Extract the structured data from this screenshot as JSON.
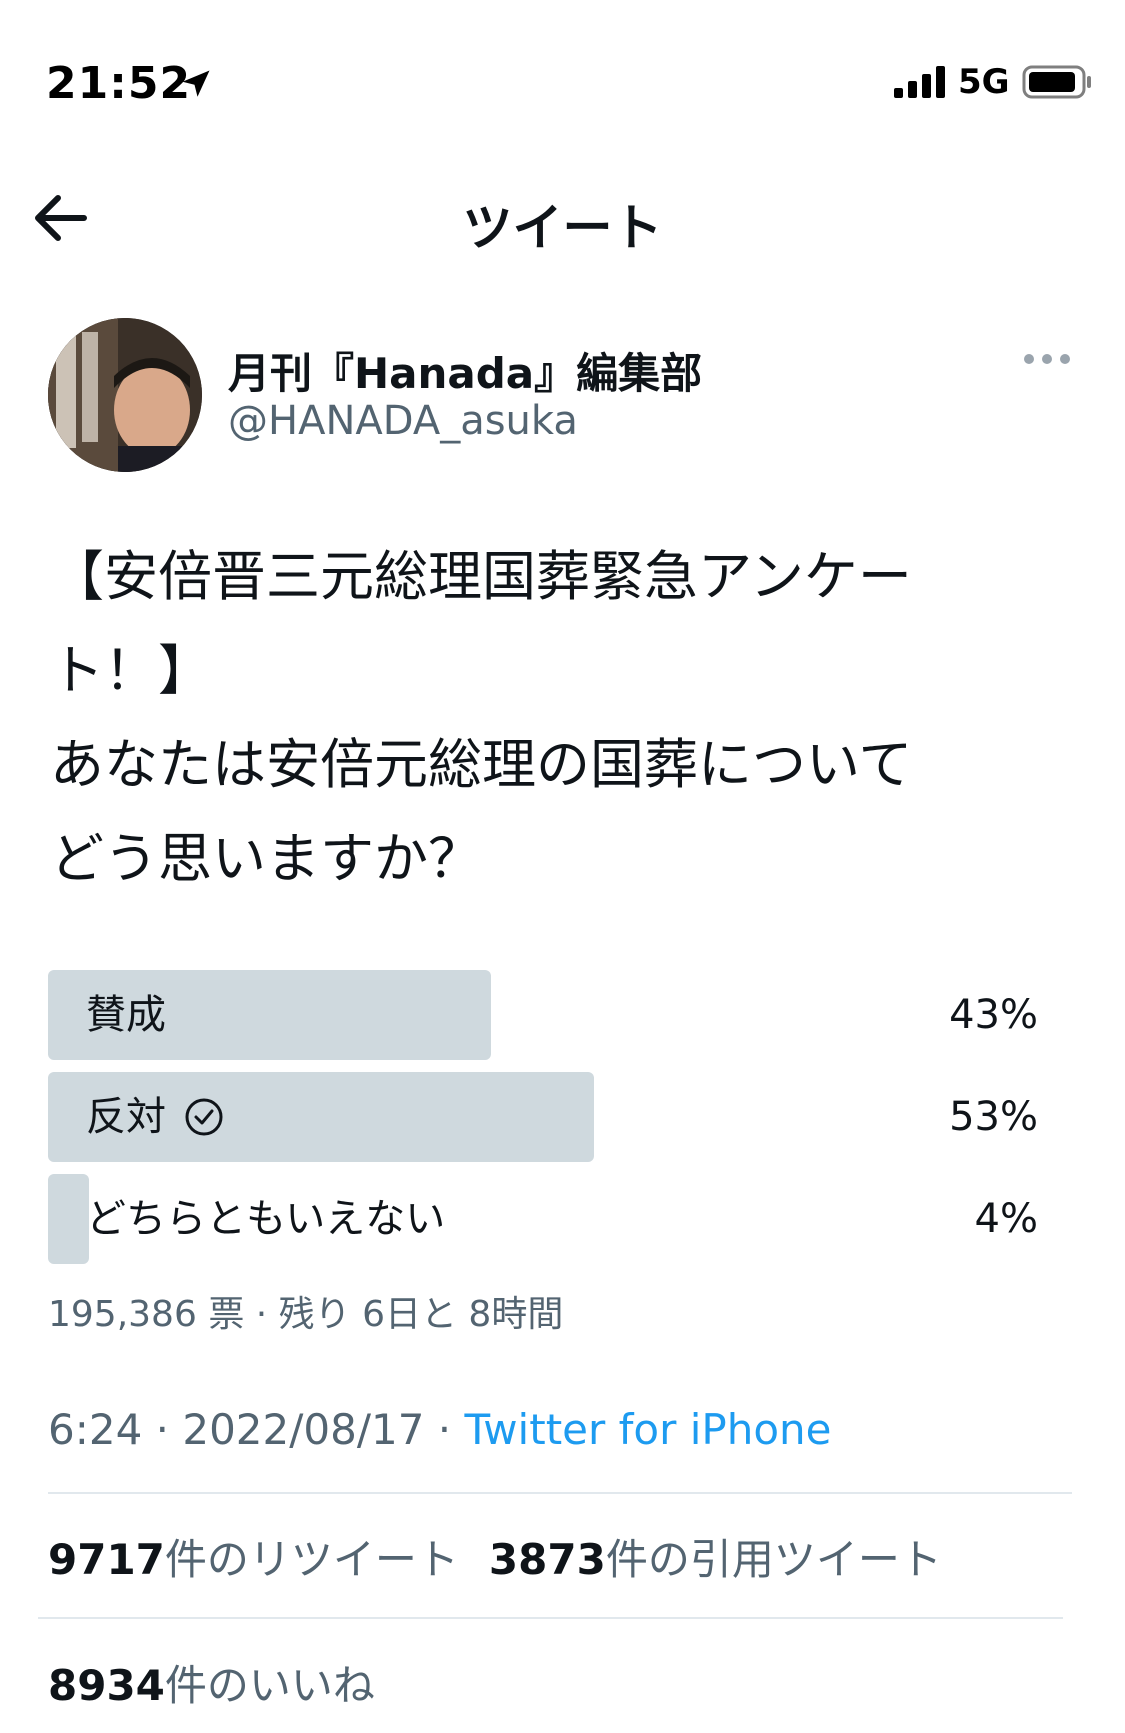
{
  "status_bar": {
    "time": "21:52",
    "network": "5G"
  },
  "header": {
    "title": "ツイート"
  },
  "tweet": {
    "author_name": "月刊『Hanada』編集部",
    "author_handle": "@HANADA_asuka",
    "text_lines": [
      "【安倍晋三元総理国葬緊急アンケー",
      "ト！】",
      "あなたは安倍元総理の国葬について",
      "どう思いますか？"
    ],
    "poll": {
      "options": [
        {
          "label": "賛成",
          "percent": "43%",
          "value": 43,
          "selected": false
        },
        {
          "label": "反対",
          "percent": "53%",
          "value": 53,
          "selected": true
        },
        {
          "label": "どちらともいえない",
          "percent": "4%",
          "value": 4,
          "selected": false
        }
      ],
      "meta": "195,386 票 · 残り 6日と 8時間"
    },
    "timestamp": "6:24 · 2022/08/17 · ",
    "source": "Twitter for iPhone",
    "stats": {
      "retweets_count": "9717",
      "retweets_label": "件のリツイート",
      "quotes_count": "3873",
      "quotes_label": "件の引用ツイート",
      "likes_count": "8934",
      "likes_label": "件のいいね"
    }
  },
  "colors": {
    "text": "#0f1419",
    "secondary": "#536471",
    "link": "#1d9bf0",
    "poll_bar": "#cfd9de",
    "divider": "#e1e8ed"
  }
}
